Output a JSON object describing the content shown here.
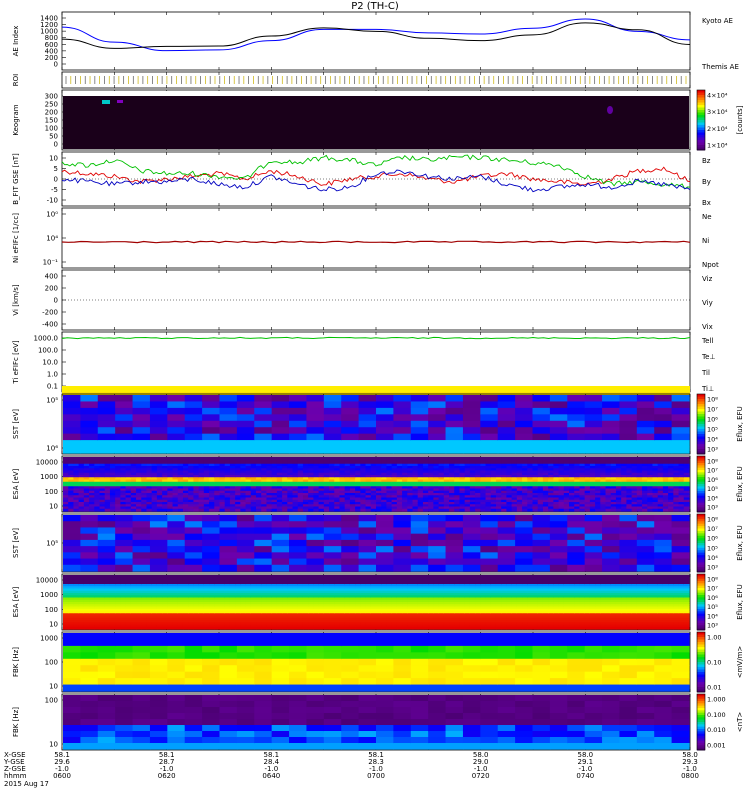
{
  "title": "P2 (TH-C)",
  "chart_data": [
    {
      "type": "line",
      "panel": "ae",
      "ylabel": "AE Index",
      "yticks": [
        "1400",
        "1200",
        "1000",
        "800",
        "600",
        "400",
        "200",
        "0"
      ],
      "ylim": [
        0,
        1500
      ],
      "x": [
        "06:00",
        "06:10",
        "06:20",
        "06:30",
        "06:40",
        "06:50",
        "07:00",
        "07:10",
        "07:20",
        "07:30",
        "07:40",
        "07:50",
        "08:00"
      ],
      "series": [
        {
          "name": "Kyoto AE",
          "color": "#0000ff",
          "values": [
            1110,
            720,
            500,
            520,
            760,
            1050,
            1050,
            960,
            930,
            1080,
            1320,
            1000,
            780
          ]
        },
        {
          "name": "Themis AE",
          "color": "#000000",
          "values": [
            800,
            560,
            610,
            620,
            880,
            1090,
            1000,
            820,
            760,
            910,
            1220,
            1040,
            660
          ]
        }
      ]
    },
    {
      "type": "table",
      "panel": "roi",
      "ylabel": "ROI"
    },
    {
      "type": "heatmap",
      "panel": "keogram",
      "ylabel": "Keogram",
      "yticks": [
        "300",
        "250",
        "200",
        "150",
        "100",
        "50",
        "0"
      ],
      "colorbar_label": "[counts]",
      "colorbar_ticks": [
        "4×10⁴",
        "3×10⁴",
        "2×10⁴",
        "1×10⁴"
      ]
    },
    {
      "type": "line",
      "panel": "bfield",
      "ylabel": "B_FIT GSE [nT]",
      "yticks": [
        "10",
        "5",
        "0",
        "-5",
        "-10"
      ],
      "ylim": [
        -10,
        10
      ],
      "x": [
        "06:00",
        "06:05",
        "06:10",
        "06:15",
        "06:20",
        "06:25",
        "06:30",
        "06:35",
        "06:40",
        "06:45",
        "06:50",
        "06:55",
        "07:00",
        "07:05",
        "07:10",
        "07:15",
        "07:20",
        "07:25",
        "07:30",
        "07:35",
        "07:40",
        "07:45",
        "07:50",
        "07:55",
        "08:00"
      ],
      "series": [
        {
          "name": "Bz",
          "color": "#e00000",
          "values": [
            3,
            2,
            1,
            -1,
            0,
            1,
            2,
            0,
            3,
            1,
            -2,
            0,
            1,
            2,
            0,
            -1,
            1,
            2,
            0,
            -1,
            -2,
            0,
            3,
            4,
            -1
          ]
        },
        {
          "name": "By",
          "color": "#00c000",
          "values": [
            6,
            5,
            7,
            3,
            2,
            2,
            1,
            0,
            7,
            6,
            8,
            7,
            5,
            8,
            7,
            8,
            8,
            7,
            6,
            5,
            1,
            -2,
            -1,
            -2,
            -3
          ]
        },
        {
          "name": "Bx",
          "color": "#0000c0",
          "values": [
            0,
            -1,
            -2,
            -1,
            -1,
            0,
            -2,
            -3,
            1,
            -2,
            -4,
            -3,
            2,
            3,
            1,
            0,
            1,
            -2,
            -4,
            -3,
            -2,
            -3,
            -1,
            -2,
            -4
          ]
        }
      ]
    },
    {
      "type": "line",
      "panel": "density",
      "ylabel": "Ni eFIFc [1/cc]",
      "yticks": [
        "10⁰",
        "10⁴",
        "10⁻¹"
      ],
      "series": [
        {
          "name": "Ne",
          "color": "#e00000"
        },
        {
          "name": "Ni",
          "color": "#000000"
        },
        {
          "name": "Npot",
          "color": "#0000c0"
        }
      ]
    },
    {
      "type": "line",
      "panel": "velocity",
      "ylabel": "Vi [km/s]",
      "yticks": [
        "400",
        "200",
        "0",
        "-200",
        "-400"
      ],
      "ylim": [
        -500,
        500
      ],
      "series": [
        {
          "name": "Viz",
          "color": "#e00000"
        },
        {
          "name": "Viy",
          "color": "#00c000"
        },
        {
          "name": "Vix",
          "color": "#0000c0"
        }
      ]
    },
    {
      "type": "line",
      "panel": "temperature",
      "ylabel": "Ti eFIFc [eV]",
      "yticks": [
        "1000.0",
        "100.0",
        "10.0",
        "1.0",
        "0.1"
      ],
      "series": [
        {
          "name": "Tell",
          "color": "#000000"
        },
        {
          "name": "Te⊥",
          "color": "#e00000"
        },
        {
          "name": "Til",
          "color": "#00c000"
        },
        {
          "name": "Ti⊥",
          "color": "#0000c0"
        }
      ]
    },
    {
      "type": "heatmap",
      "panel": "sst1",
      "ylabel": "SST [eV]",
      "yticks": [
        "10⁵",
        "10⁶"
      ]
    },
    {
      "type": "heatmap",
      "panel": "esa1",
      "ylabel": "ESA [eV]",
      "yticks": [
        "10000",
        "1000",
        "100",
        "10"
      ]
    },
    {
      "type": "heatmap",
      "panel": "sst2",
      "ylabel": "SST [eV]",
      "yticks": [
        "10⁵"
      ]
    },
    {
      "type": "heatmap",
      "panel": "esa2",
      "ylabel": "ESA [eV]",
      "yticks": [
        "10000",
        "1000",
        "100",
        "10"
      ]
    },
    {
      "type": "heatmap",
      "panel": "fbk1",
      "ylabel": "FBK [Hz]",
      "yticks": [
        "1000",
        "100",
        "10"
      ],
      "colorbar_ticks": [
        "1.00",
        "0.10",
        "0.01"
      ],
      "colorbar_label": "<mV/m>"
    },
    {
      "type": "heatmap",
      "panel": "fbk2",
      "ylabel": "FBK [Hz]",
      "yticks": [
        "100",
        "10"
      ],
      "colorbar_ticks": [
        "1.000",
        "0.100",
        "0.010",
        "0.001"
      ],
      "colorbar_label": "<nT>"
    }
  ],
  "efu_colorbar": {
    "label": "Eflux, EFU",
    "ticks": [
      "10⁸",
      "10⁷",
      "10⁶",
      "10⁵",
      "10⁴",
      "10³"
    ]
  },
  "time_axis": {
    "row_labels": [
      "X-GSE",
      "Y-GSE",
      "Z-GSE",
      "hhmm",
      "2015 Aug 17"
    ],
    "columns": [
      {
        "x": "58.1",
        "y": "29.6",
        "z": "-1.0",
        "t": "0600"
      },
      {
        "x": "58.1",
        "y": "28.7",
        "z": "-1.0",
        "t": "0620"
      },
      {
        "x": "58.1",
        "y": "28.4",
        "z": "-1.0",
        "t": "0640"
      },
      {
        "x": "58.1",
        "y": "28.3",
        "z": "-1.0",
        "t": "0700"
      },
      {
        "x": "58.0",
        "y": "29.0",
        "z": "-1.0",
        "t": "0720"
      },
      {
        "x": "58.0",
        "y": "29.1",
        "z": "-1.0",
        "t": "0740"
      },
      {
        "x": "58.0",
        "y": "29.3",
        "z": "-1.0",
        "t": "0800"
      }
    ]
  }
}
